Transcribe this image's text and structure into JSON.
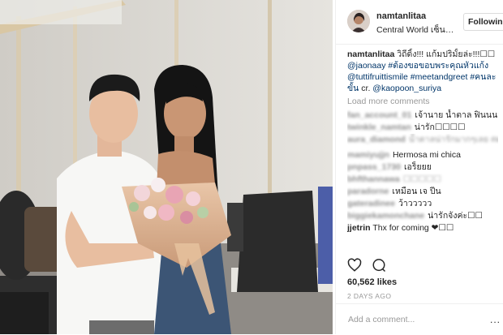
{
  "post": {
    "username": "namtanlitaa",
    "location": "Central World เซ็นทรัลเวิลด์",
    "follow_label": "Following"
  },
  "caption": {
    "username": "namtanlitaa",
    "text": " วิถีดิ้ง!!! แก้มปริมั้ยล่ะ!!!☐☐ ",
    "tags": [
      "@jaonaay",
      " #ต้องขอขอบพระคุณหัวแก้ง",
      "@tuttifruittismile",
      " #meetandgreet",
      " #คนละขั้น",
      "@kaopoon_suriya"
    ],
    "cr_prefix": "cr. "
  },
  "load_more": "Load more comments",
  "comments": [
    {
      "username": "fan_account_01",
      "text": "เจ้านาย น้ำตาล ฟินนนนน~",
      "blurred_text": false
    },
    {
      "username": "twinkle_namtan",
      "text": "น่ารัก☐☐☐☐",
      "blurred_text": false
    },
    {
      "username": "aura_diamond",
      "text": "น้ำตาลน่ารักมากๆเลย #ผมหน้ารักออกอู",
      "blurred_text": true
    },
    {
      "username": "mamiyujjn",
      "text": "Hermosa mi chica",
      "blurred_text": false
    },
    {
      "username": "pnpass_1730",
      "text": "เอร็ยยย",
      "blurred_text": false
    },
    {
      "username": "bhfthannawa",
      "text": "☐☐☐☐☐",
      "blurred_text": true
    },
    {
      "username": "paradorne",
      "text": "เหมือน เจ ปีน",
      "blurred_text": false
    },
    {
      "username": "gateradinee",
      "text": "ว้าววววว",
      "blurred_text": false
    },
    {
      "username": "biggiekamonchane",
      "text": "น่ารักจังค่ะ☐☐",
      "blurred_text": false
    },
    {
      "username": "jjetrin",
      "text": "Thx for coming ❤☐☐",
      "blurred_text": false,
      "visible_user": true
    }
  ],
  "likes": "60,562 likes",
  "time_ago": "2 DAYS AGO",
  "comment_input": {
    "placeholder": "Add a comment..."
  },
  "more_icon": "...",
  "icons": [
    "heart-icon",
    "comment-icon",
    "more-options-icon"
  ],
  "colors": {
    "link": "#003569",
    "muted": "#999999",
    "border": "#efefef",
    "text": "#262626"
  }
}
